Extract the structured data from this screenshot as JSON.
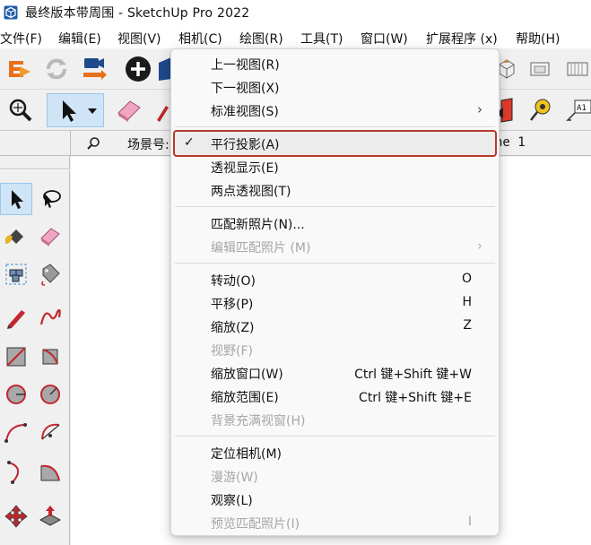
{
  "window": {
    "title": "最终版本带周围 - SketchUp Pro 2022",
    "app_icon": "sketchup-logo-icon"
  },
  "menubar": {
    "items": [
      {
        "label": "文件(F)"
      },
      {
        "label": "编辑(E)"
      },
      {
        "label": "视图(V)"
      },
      {
        "label": "相机(C)"
      },
      {
        "label": "绘图(R)"
      },
      {
        "label": "工具(T)"
      },
      {
        "label": "窗口(W)"
      },
      {
        "label": "扩展程序 (x)"
      },
      {
        "label": "帮助(H)"
      }
    ]
  },
  "scenebar": {
    "label": "场景号:",
    "tab_partial": "ne 1"
  },
  "camera_menu": {
    "items": [
      {
        "label": "上一视图(R)"
      },
      {
        "label": "下一视图(X)"
      },
      {
        "label": "标准视图(S)",
        "submenu": true
      },
      {
        "label": "平行投影(A)",
        "checked": true,
        "highlighted": true
      },
      {
        "label": "透视显示(E)"
      },
      {
        "label": "两点透视图(T)"
      },
      {
        "label": "匹配新照片(N)..."
      },
      {
        "label": "编辑匹配照片 (M)",
        "disabled": true,
        "submenu": true
      },
      {
        "label": "转动(O)",
        "shortcut": "O"
      },
      {
        "label": "平移(P)",
        "shortcut": "H"
      },
      {
        "label": "缩放(Z)",
        "shortcut": "Z"
      },
      {
        "label": "视野(F)",
        "disabled": true
      },
      {
        "label": "缩放窗口(W)",
        "shortcut": "Ctrl 键+Shift 键+W"
      },
      {
        "label": "缩放范围(E)",
        "shortcut": "Ctrl 键+Shift 键+E"
      },
      {
        "label": "背景充满视窗(H)",
        "disabled": true
      },
      {
        "label": "定位相机(M)"
      },
      {
        "label": "漫游(W)",
        "disabled": true
      },
      {
        "label": "观察(L)"
      },
      {
        "label": "预览匹配照片(I)",
        "disabled": true,
        "shortcut": "I"
      }
    ],
    "check_glyph": "✓",
    "submenu_glyph": "›"
  },
  "colors": {
    "highlight_border": "#b53a2a",
    "disabled_text": "#a6a6a6",
    "selected_tool_bg": "#cfe4f7"
  }
}
